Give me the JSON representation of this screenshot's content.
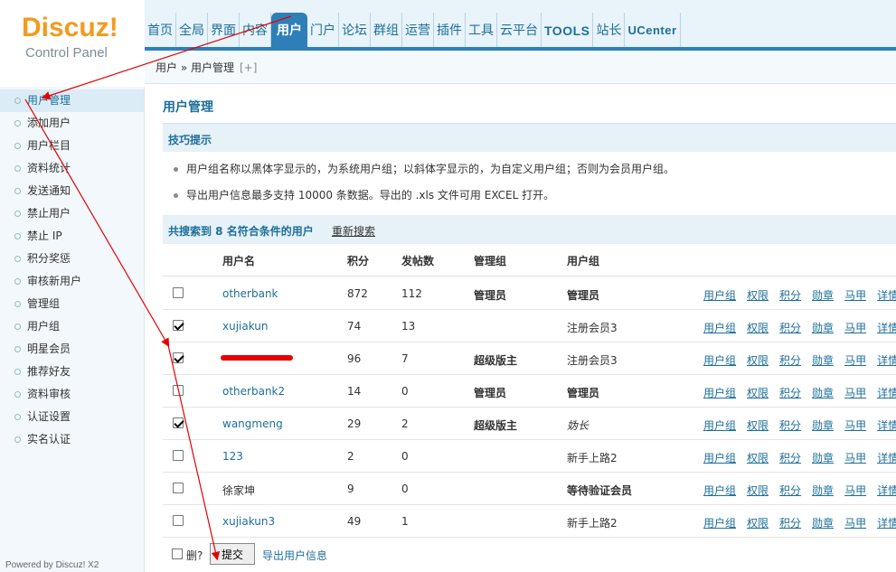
{
  "logo": {
    "brand": "Discuz!",
    "subtitle": "Control Panel"
  },
  "nav": {
    "tabs": [
      {
        "label": "首页"
      },
      {
        "label": "全局"
      },
      {
        "label": "界面"
      },
      {
        "label": "内容"
      },
      {
        "label": "用户",
        "active": true
      },
      {
        "label": "门户"
      },
      {
        "label": "论坛"
      },
      {
        "label": "群组"
      },
      {
        "label": "运营"
      },
      {
        "label": "插件"
      },
      {
        "label": "工具"
      },
      {
        "label": "云平台"
      },
      {
        "label": "TOOLS"
      },
      {
        "label": "站长"
      },
      {
        "label": "UCenter"
      }
    ]
  },
  "breadcrumb": {
    "path": "用户 » 用户管理",
    "add": "[+]"
  },
  "sidebar": {
    "items": [
      {
        "label": "用户管理",
        "active": true
      },
      {
        "label": "添加用户"
      },
      {
        "label": "用户栏目"
      },
      {
        "label": "资料统计"
      },
      {
        "label": "发送通知"
      },
      {
        "label": "禁止用户"
      },
      {
        "label": "禁止 IP"
      },
      {
        "label": "积分奖惩"
      },
      {
        "label": "审核新用户"
      },
      {
        "label": "管理组"
      },
      {
        "label": "用户组"
      },
      {
        "label": "明星会员"
      },
      {
        "label": "推荐好友"
      },
      {
        "label": "资料审核"
      },
      {
        "label": "认证设置"
      },
      {
        "label": "实名认证"
      }
    ],
    "powered": "Powered by Discuz! X2"
  },
  "main": {
    "title": "用户管理",
    "tips_title": "技巧提示",
    "tips": [
      "用户组名称以黑体字显示的，为系统用户组；以斜体字显示的，为自定义用户组；否则为会员用户组。",
      "导出用户信息最多支持  10000 条数据。导出的  .xls 文件可用  EXCEL 打开。"
    ],
    "result_text": "共搜索到  8 名符合条件的用户",
    "research": "重新搜索",
    "columns": [
      "用户名",
      "积分",
      "发帖数",
      "管理组",
      "用户组"
    ],
    "actions": [
      "用户组",
      "权限",
      "积分",
      "勋章",
      "马甲",
      "详情"
    ],
    "rows": [
      {
        "name": "otherbank",
        "points": "872",
        "posts": "112",
        "admin_group": "管理员",
        "user_group": "管理员",
        "checked": false,
        "ug_style": "b"
      },
      {
        "name": "xujiakun",
        "points": "74",
        "posts": "13",
        "admin_group": "",
        "user_group": "注册会员3",
        "checked": true,
        "ug_style": ""
      },
      {
        "name": "",
        "points": "96",
        "posts": "7",
        "admin_group": "超级版主",
        "user_group": "注册会员3",
        "checked": true,
        "ug_style": "",
        "redacted": true
      },
      {
        "name": "otherbank2",
        "points": "14",
        "posts": "0",
        "admin_group": "管理员",
        "user_group": "管理员",
        "checked": false,
        "ug_style": "b"
      },
      {
        "name": "wangmeng",
        "points": "29",
        "posts": "2",
        "admin_group": "超级版主",
        "user_group": "妫长",
        "checked": true,
        "ug_style": "i"
      },
      {
        "name": "123",
        "points": "2",
        "posts": "0",
        "admin_group": "",
        "user_group": "新手上路2",
        "checked": false,
        "ug_style": ""
      },
      {
        "name": "徐家坤",
        "points": "9",
        "posts": "0",
        "admin_group": "",
        "user_group": "等待验证会员",
        "checked": false,
        "ug_style": "b",
        "plain": true
      },
      {
        "name": "xujiakun3",
        "points": "49",
        "posts": "1",
        "admin_group": "",
        "user_group": "新手上路2",
        "checked": false,
        "ug_style": ""
      }
    ],
    "footer": {
      "delete_label": "删?",
      "submit": "提交",
      "export": "导出用户信息"
    }
  },
  "colors": {
    "accent": "#2e7fb8",
    "link": "#1d6f9a",
    "logo": "#f39a1e",
    "annotation": "#e60000"
  }
}
